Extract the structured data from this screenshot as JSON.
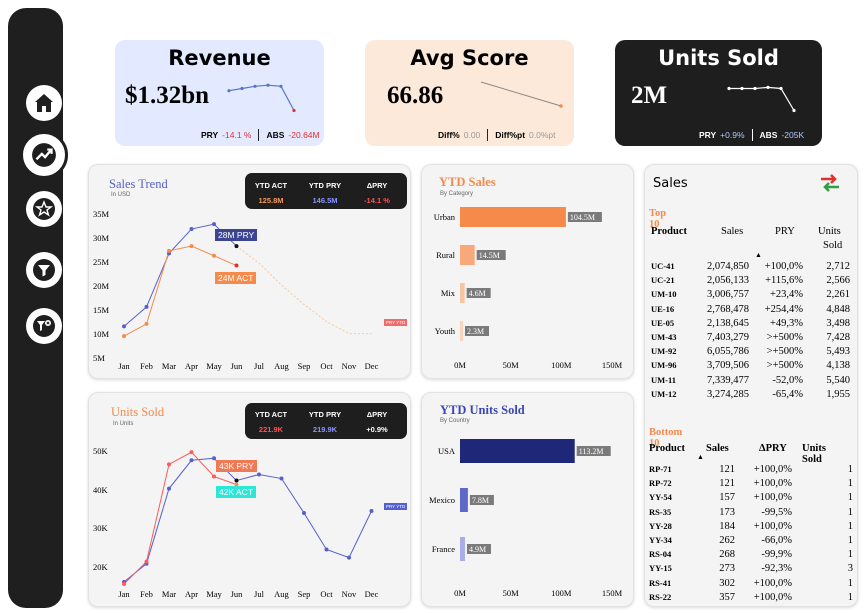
{
  "nav": {
    "items": [
      "home-icon",
      "trend-icon",
      "star-icon",
      "filter-icon",
      "filter-clear-icon"
    ]
  },
  "kpis": {
    "revenue": {
      "title": "Revenue",
      "value": "$1.32bn",
      "pry_label": "PRY",
      "pry": "-14.1 %",
      "abs_label": "ABS",
      "abs": "-20.64M",
      "spark": [
        78,
        80,
        82,
        83,
        82,
        60
      ]
    },
    "avg_score": {
      "title": "Avg Score",
      "value": "66.86",
      "diff_label": "Diff%",
      "diff": "0.00",
      "diffpt_label": "Diff%pt",
      "diffpt": "0.0%pt"
    },
    "units": {
      "title": "Units Sold",
      "value": "2M",
      "pry_label": "PRY",
      "pry": "+0.9%",
      "abs_label": "ABS",
      "abs": "-205K",
      "spark": [
        80,
        80,
        80,
        81,
        80,
        60
      ]
    }
  },
  "sales_trend": {
    "title": "Sales Trend",
    "subtitle": "In USD",
    "stats": {
      "h1": "YTD ACT",
      "h2": "YTD PRY",
      "h3": "ΔPRY",
      "v1": "125.8M",
      "v2": "146.5M",
      "v3": "-14.1 %"
    },
    "label_pry": "28M PRY",
    "label_act": "24M ACT",
    "tag": "PRY YTD"
  },
  "units_trend": {
    "title": "Units Sold",
    "subtitle": "In Units",
    "stats": {
      "h1": "YTD ACT",
      "h2": "YTD PRY",
      "h3": "ΔPRY",
      "v1": "221.9K",
      "v2": "219.9K",
      "v3": "+0.9%"
    },
    "label_pry": "43K PRY",
    "label_act": "42K ACT",
    "tag": "PRY YTD"
  },
  "ytd_sales": {
    "title": "YTD Sales",
    "subtitle": "By Category"
  },
  "ytd_units": {
    "title": "YTD Units Sold",
    "subtitle": "By Country"
  },
  "chart_data": [
    {
      "type": "line",
      "title": "Sales Trend",
      "categories": [
        "Jan",
        "Feb",
        "Mar",
        "Apr",
        "May",
        "Jun",
        "Jul",
        "Aug",
        "Sep",
        "Oct",
        "Nov",
        "Dec"
      ],
      "yticks": [
        "5M",
        "10M",
        "15M",
        "20M",
        "25M",
        "30M",
        "35M"
      ],
      "ylim": [
        5,
        35
      ],
      "series": [
        {
          "name": "PRY",
          "values": [
            11.5,
            15.5,
            26.5,
            31.5,
            32.5,
            28,
            24.5,
            20,
            16,
            12.5,
            10,
            10
          ]
        },
        {
          "name": "ACT",
          "values": [
            9.5,
            12,
            27,
            28,
            26,
            24
          ]
        }
      ]
    },
    {
      "type": "line",
      "title": "Units Sold",
      "categories": [
        "Jan",
        "Feb",
        "Mar",
        "Apr",
        "May",
        "Jun",
        "Jul",
        "Aug",
        "Sep",
        "Oct",
        "Nov",
        "Dec"
      ],
      "yticks": [
        "20K",
        "30K",
        "40K",
        "50K"
      ],
      "ylim": [
        17,
        53
      ],
      "series": [
        {
          "name": "PRY",
          "values": [
            18,
            22.5,
            41,
            48,
            48.5,
            43,
            44.5,
            43.5,
            35,
            26,
            24,
            35.5
          ]
        },
        {
          "name": "ACT",
          "values": [
            17.5,
            23,
            47,
            50,
            44,
            42
          ]
        }
      ]
    },
    {
      "type": "bar",
      "title": "YTD Sales",
      "categories": [
        "Urban",
        "Rural",
        "Mix",
        "Youth"
      ],
      "values": [
        104.5,
        14.5,
        4.6,
        2.3
      ],
      "labels": [
        "104.5M",
        "14.5M",
        "4.6M",
        "2.3M"
      ],
      "xticks": [
        "0M",
        "50M",
        "100M",
        "150M"
      ],
      "xlim": [
        0,
        150
      ]
    },
    {
      "type": "bar",
      "title": "YTD Units Sold",
      "categories": [
        "USA",
        "Mexico",
        "France"
      ],
      "values": [
        113.2,
        7.8,
        4.9
      ],
      "labels": [
        "113.2M",
        "7.8M",
        "4.9M"
      ],
      "xticks": [
        "0M",
        "50M",
        "100M",
        "150M"
      ],
      "xlim": [
        0,
        150
      ]
    }
  ],
  "sales_panel": {
    "title": "Sales",
    "top": {
      "heading": "Top 10",
      "cols": [
        "Product",
        "Sales",
        "PRY",
        "Units",
        "Sold"
      ],
      "rows": [
        [
          "UC-41",
          "2,074,850",
          "+100,0%",
          "2,712"
        ],
        [
          "UC-21",
          "2,056,133",
          "+115,6%",
          "2,566"
        ],
        [
          "UM-10",
          "3,006,757",
          "+23,4%",
          "2,261"
        ],
        [
          "UE-16",
          "2,768,478",
          "+254,4%",
          "4,848"
        ],
        [
          "UE-05",
          "2,138,645",
          "+49,3%",
          "3,498"
        ],
        [
          "UM-43",
          "7,403,279",
          ">+500%",
          "7,428"
        ],
        [
          "UM-92",
          "6,055,786",
          ">+500%",
          "5,493"
        ],
        [
          "UM-96",
          "3,709,506",
          ">+500%",
          "4,138"
        ],
        [
          "UM-11",
          "7,339,477",
          "-52,0%",
          "5,540"
        ],
        [
          "UM-12",
          "3,274,285",
          "-65,4%",
          "1,955"
        ]
      ]
    },
    "bottom": {
      "heading": "Bottom 10",
      "cols": [
        "Product",
        "Sales",
        "ΔPRY",
        "Units Sold"
      ],
      "rows": [
        [
          "RP-71",
          "121",
          "+100,0%",
          "1"
        ],
        [
          "RP-72",
          "121",
          "+100,0%",
          "1"
        ],
        [
          "YY-54",
          "157",
          "+100,0%",
          "1"
        ],
        [
          "RS-35",
          "173",
          "-99,5%",
          "1"
        ],
        [
          "YY-28",
          "184",
          "+100,0%",
          "1"
        ],
        [
          "YY-34",
          "262",
          "-66,0%",
          "1"
        ],
        [
          "RS-04",
          "268",
          "-99,9%",
          "1"
        ],
        [
          "YY-15",
          "273",
          "-92,3%",
          "3"
        ],
        [
          "RS-41",
          "302",
          "+100,0%",
          "1"
        ],
        [
          "RS-22",
          "357",
          "+100,0%",
          "1"
        ]
      ]
    }
  }
}
